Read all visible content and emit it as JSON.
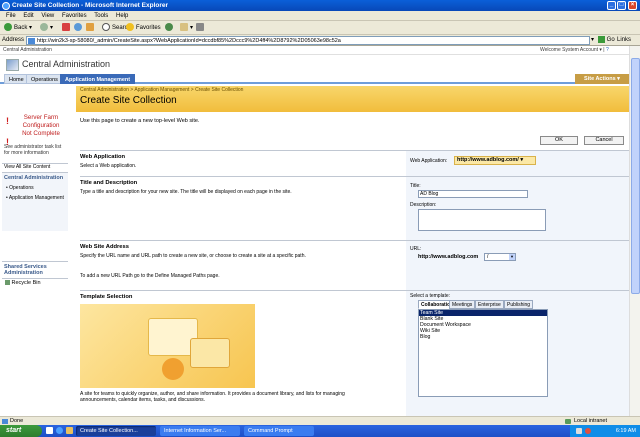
{
  "window": {
    "title": "Create Site Collection - Microsoft Internet Explorer"
  },
  "menu": [
    "File",
    "Edit",
    "View",
    "Favorites",
    "Tools",
    "Help"
  ],
  "toolbar": {
    "back": "Back",
    "search": "Search",
    "favorites": "Favorites"
  },
  "address": {
    "label": "Address",
    "url": "http://win2k3-sp-58080/_admin/CreateSite.aspx?WebApplicationId=dccdbf85%2Dccc9%2D4ff4%2D8792%2D05063e98c52a",
    "go": "Go",
    "links": "Links"
  },
  "sp": {
    "site_name": "Central Administration",
    "welcome": "Welcome System Account",
    "banner_title": "Central Administration",
    "tabs": [
      "Home",
      "Operations",
      "Application Management"
    ],
    "site_actions": "Site Actions"
  },
  "leftnav": {
    "warning_lines": [
      "Server Farm",
      "Configuration",
      "Not Complete"
    ],
    "see_text": "See administrator task list for more information",
    "view_all": "View All Site Content",
    "central_admin": "Central Administration",
    "ops": "Operations",
    "appmgmt": "Application Management",
    "ssa": "Shared Services Administration",
    "recycle": "Recycle Bin"
  },
  "title": {
    "breadcrumb": "Central Administration > Application Management > Create Site Collection",
    "page_title": "Create Site Collection"
  },
  "form": {
    "intro": "Use this page to create a new top-level Web site.",
    "ok": "OK",
    "cancel": "Cancel",
    "webapp_title": "Web Application",
    "webapp_desc": "Select a Web application.",
    "webapp_label": "Web Application:",
    "webapp_value": "http://www.adblog.com/",
    "td_title": "Title and Description",
    "td_desc": "Type a title and description for your new site. The title will be displayed on each page in the site.",
    "title_label": "Title:",
    "title_value": "AD Blog",
    "desc_label": "Description:",
    "addr_title": "Web Site Address",
    "addr_desc": "Specify the URL name and URL path to create a new site, or choose to create a site at a specific path.",
    "addr_desc2": "To add a new URL Path go to the Define Managed Paths page.",
    "url_label": "URL:",
    "url_prefix": "http://www.adblog.com",
    "url_path": "/",
    "tpl_title": "Template Selection",
    "tpl_label": "Select a template:",
    "tpl_tabs": [
      "Collaboration",
      "Meetings",
      "Enterprise",
      "Publishing"
    ],
    "tpl_items": [
      "Team Site",
      "Blank Site",
      "Document Workspace",
      "Wiki Site",
      "Blog"
    ],
    "tpl_desc": "A site for teams to quickly organize, author, and share information. It provides a document library, and lists for managing announcements, calendar items, tasks, and discussions."
  },
  "status": {
    "left": "Done",
    "zone": "Local intranet"
  },
  "taskbar": {
    "start": "start",
    "tasks": [
      "Create Site Collection...",
      "Internet Information Ser...",
      "Command Prompt"
    ],
    "clock": "6:19 AM"
  }
}
